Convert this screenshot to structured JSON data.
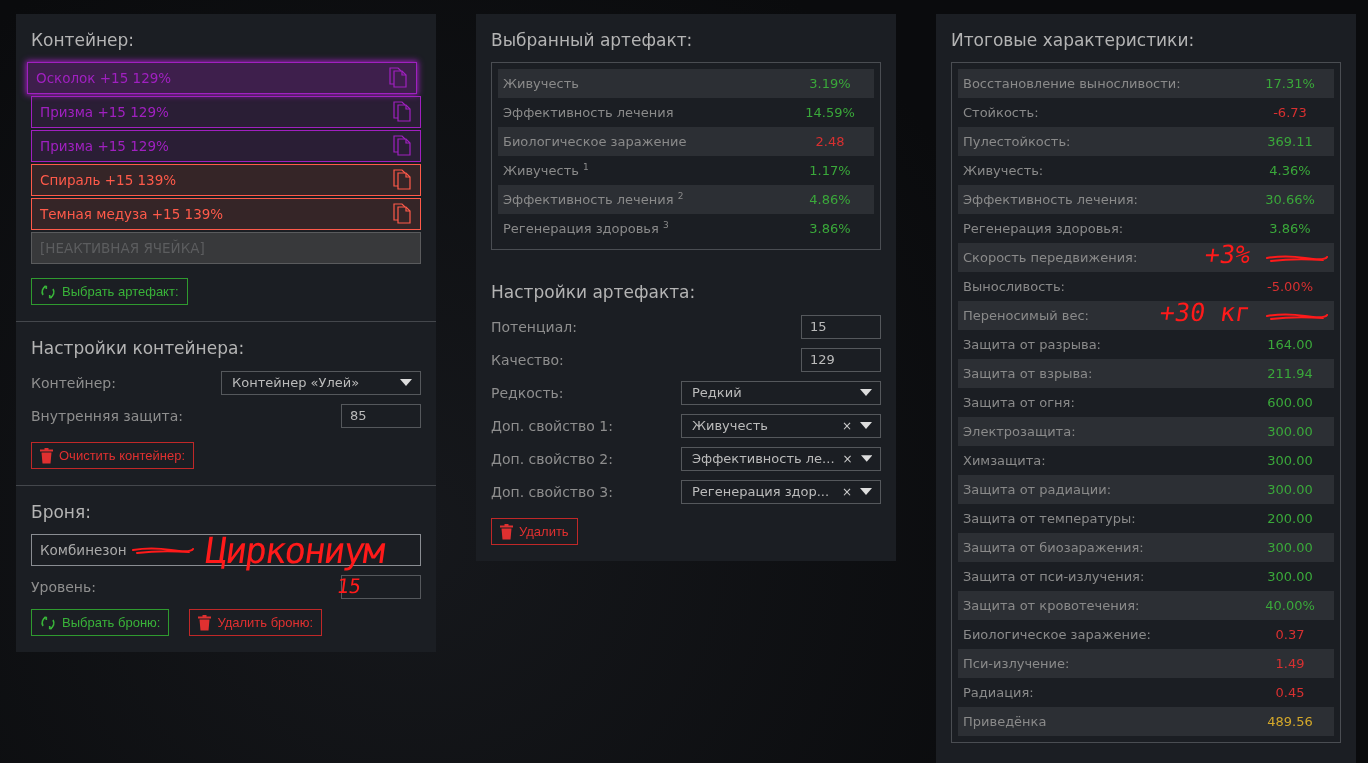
{
  "container": {
    "title": "Контейнер:",
    "slots": [
      {
        "label": "Осколок +15 129%",
        "color": "#a020c0",
        "selected": true
      },
      {
        "label": "Призма +15 129%",
        "color": "#a020c0",
        "selected": false
      },
      {
        "label": "Призма +15 129%",
        "color": "#a020c0",
        "selected": false
      },
      {
        "label": "Спираль +15 139%",
        "color": "#ff5a4a",
        "selected": false
      },
      {
        "label": "Темная медуза +15 139%",
        "color": "#ff5a4a",
        "selected": false
      },
      {
        "label": "[НЕАКТИВНАЯ ЯЧЕЙКА]",
        "kind": "inactive",
        "selected": false
      }
    ],
    "button": "Выбрать артефакт:"
  },
  "container_settings": {
    "title": "Настройки контейнера:",
    "fields": [
      {
        "kind": "select",
        "label": "Контейнер:",
        "value": "Контейнер «Улей»"
      },
      {
        "kind": "input",
        "label": "Внутренняя защита:",
        "value": "85"
      }
    ],
    "button": "Очистить контейнер:"
  },
  "armor": {
    "title": "Броня:",
    "value": "Комбинезон",
    "struck": true,
    "note": "Циркониум",
    "level_label": "Уровень:",
    "level_note": "15",
    "buttons": [
      {
        "kind": "select",
        "label": "Выбрать броню:"
      },
      {
        "kind": "delete",
        "label": "Удалить броню:"
      }
    ]
  },
  "artifact": {
    "title": "Выбранный артефакт:",
    "stats": [
      {
        "name": "Живучесть",
        "value": "3.19%",
        "color": "#3aa83a"
      },
      {
        "name": "Эффективность лечения",
        "value": "14.59%",
        "color": "#3aa83a"
      },
      {
        "name": "Биологическое заражение",
        "value": "2.48",
        "color": "#d83030"
      },
      {
        "name": "Живучесть $^{1}$",
        "value": "1.17%",
        "color": "#3aa83a"
      },
      {
        "name": "Эффективность лечения $^{2}$",
        "value": "4.86%",
        "color": "#3aa83a"
      },
      {
        "name": "Регенерация здоровья $^{3}$",
        "value": "3.86%",
        "color": "#3aa83a"
      }
    ]
  },
  "artifact_settings": {
    "title": "Настройки артефакта:",
    "fields": [
      {
        "kind": "input",
        "label": "Потенциал:",
        "value": "15"
      },
      {
        "kind": "input",
        "label": "Качество:",
        "value": "129"
      },
      {
        "kind": "select",
        "label": "Редкость:",
        "value": "Редкий"
      },
      {
        "kind": "select",
        "label": "Доп. свойство 1:",
        "value": "Живучесть",
        "clear": "×"
      },
      {
        "kind": "select",
        "label": "Доп. свойство 2:",
        "value": "Эффективность ле...",
        "clear": "×"
      },
      {
        "kind": "select",
        "label": "Доп. свойство 3:",
        "value": "Регенерация здор...",
        "clear": "×"
      }
    ],
    "button": "Удалить"
  },
  "totals": {
    "title": "Итоговые характеристики:",
    "stats": [
      {
        "name": "Восстановление выносливости:",
        "value": "17.31%",
        "color": "#3aa83a"
      },
      {
        "name": "Стойкость:",
        "value": "-6.73",
        "color": "#d83030"
      },
      {
        "name": "Пулестойкость:",
        "value": "369.11",
        "color": "#3aa83a"
      },
      {
        "name": "Живучесть:",
        "value": "4.36%",
        "color": "#3aa83a"
      },
      {
        "name": "Эффективность лечения:",
        "value": "30.66%",
        "color": "#3aa83a"
      },
      {
        "name": "Регенерация здоровья:",
        "value": "3.86%",
        "color": "#3aa83a"
      },
      {
        "name": "Скорость передвижения:",
        "struck": true,
        "note": "+3%"
      },
      {
        "name": "Выносливость:",
        "value": "-5.00%",
        "color": "#d83030"
      },
      {
        "name": "Переносимый вес:",
        "struck": true,
        "note": "+30 кг"
      },
      {
        "name": "Защита от разрыва:",
        "value": "164.00",
        "color": "#3aa83a"
      },
      {
        "name": "Защита от взрыва:",
        "value": "211.94",
        "color": "#3aa83a"
      },
      {
        "name": "Защита от огня:",
        "value": "600.00",
        "color": "#3aa83a"
      },
      {
        "name": "Электрозащита:",
        "value": "300.00",
        "color": "#3aa83a"
      },
      {
        "name": "Химзащита:",
        "value": "300.00",
        "color": "#3aa83a"
      },
      {
        "name": "Защита от радиации:",
        "value": "300.00",
        "color": "#3aa83a"
      },
      {
        "name": "Защита от температуры:",
        "value": "200.00",
        "color": "#3aa83a"
      },
      {
        "name": "Защита от биозаражения:",
        "value": "300.00",
        "color": "#3aa83a"
      },
      {
        "name": "Защита от пси-излучения:",
        "value": "300.00",
        "color": "#3aa83a"
      },
      {
        "name": "Защита от кровотечения:",
        "value": "40.00%",
        "color": "#3aa83a"
      },
      {
        "name": "Биологическое заражение:",
        "value": "0.37",
        "color": "#d83030"
      },
      {
        "name": "Пси-излучение:",
        "value": "1.49",
        "color": "#d83030"
      },
      {
        "name": "Радиация:",
        "value": "0.45",
        "color": "#d83030"
      },
      {
        "name": "Приведёнка",
        "value": "489.56",
        "color": "#d4a82a"
      }
    ]
  }
}
